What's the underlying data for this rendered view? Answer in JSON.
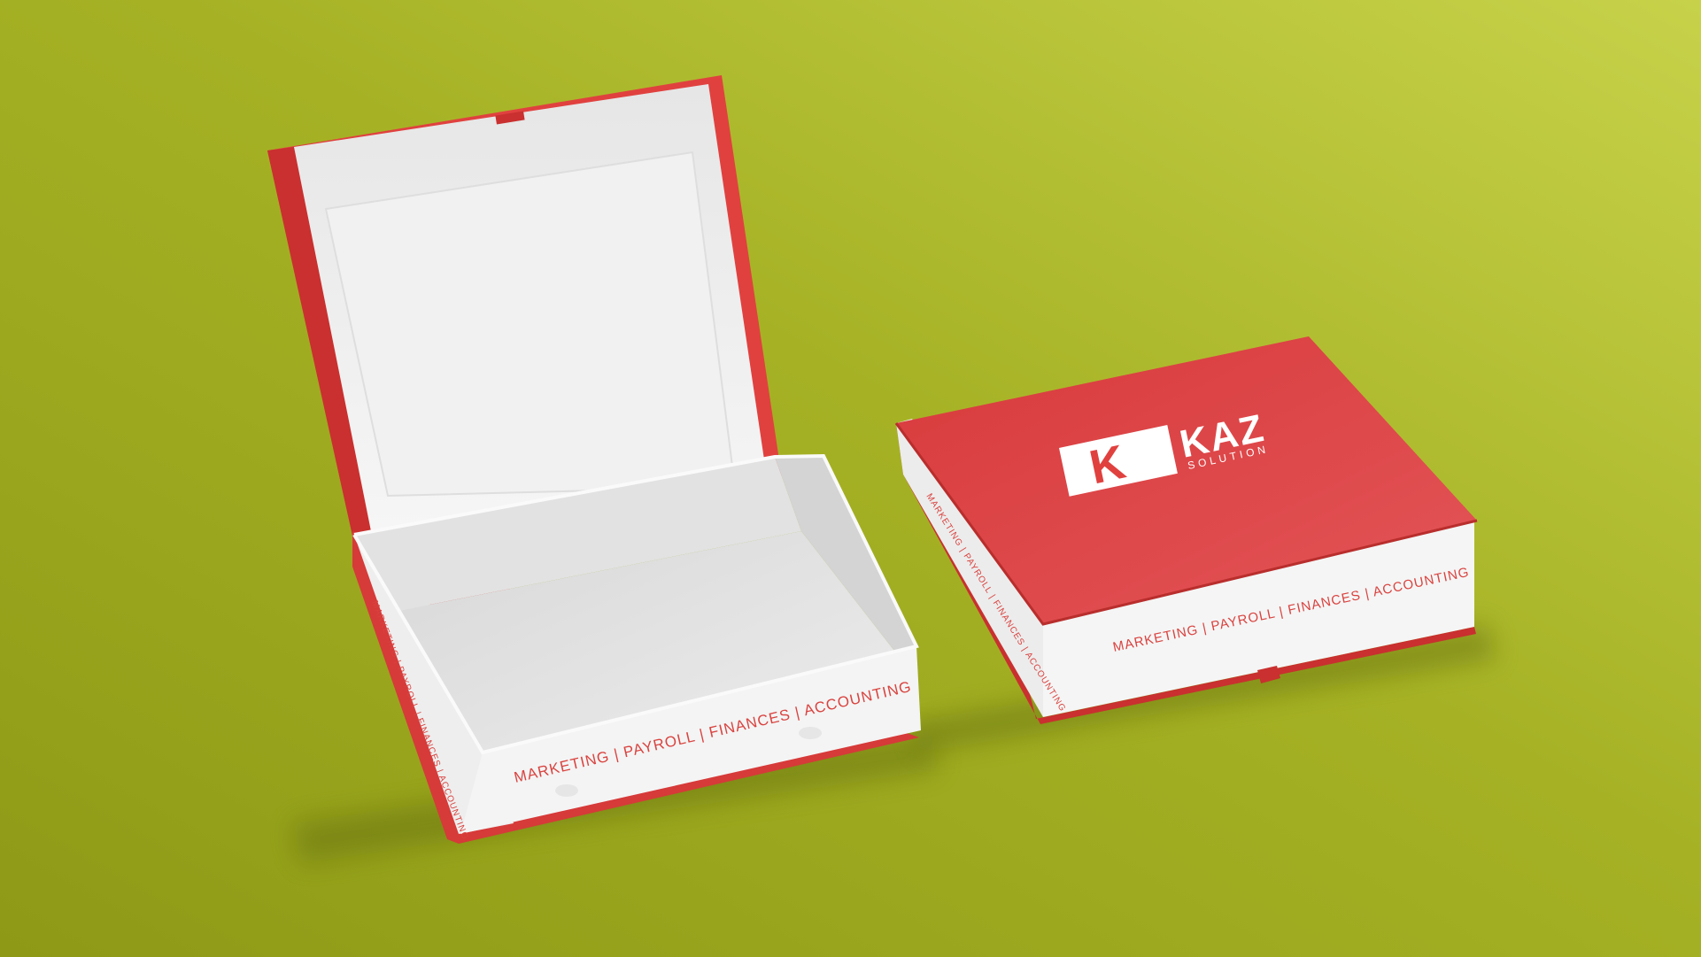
{
  "colors": {
    "background_light": "#c4cf45",
    "background_dark": "#8e9a16",
    "box_red": "#e0413f",
    "box_red_dark": "#b52a29",
    "box_white": "#f3f3f3",
    "box_white_shade": "#dcdcdc",
    "text_red": "#d9433f"
  },
  "open_box": {
    "front_tagline": "MARKETING | PAYROLL | FINANCES | ACCOUNTING",
    "side_tagline": "MARKETING | PAYROLL | FINANCES | ACCOUNTING"
  },
  "closed_box": {
    "logo_letter": "K",
    "logo_word": "KAZ",
    "logo_subword": "SOLUTION",
    "front_tagline": "MARKETING | PAYROLL | FINANCES | ACCOUNTING",
    "side_tagline": "MARKETING | PAYROLL | FINANCES | ACCOUNTING"
  }
}
